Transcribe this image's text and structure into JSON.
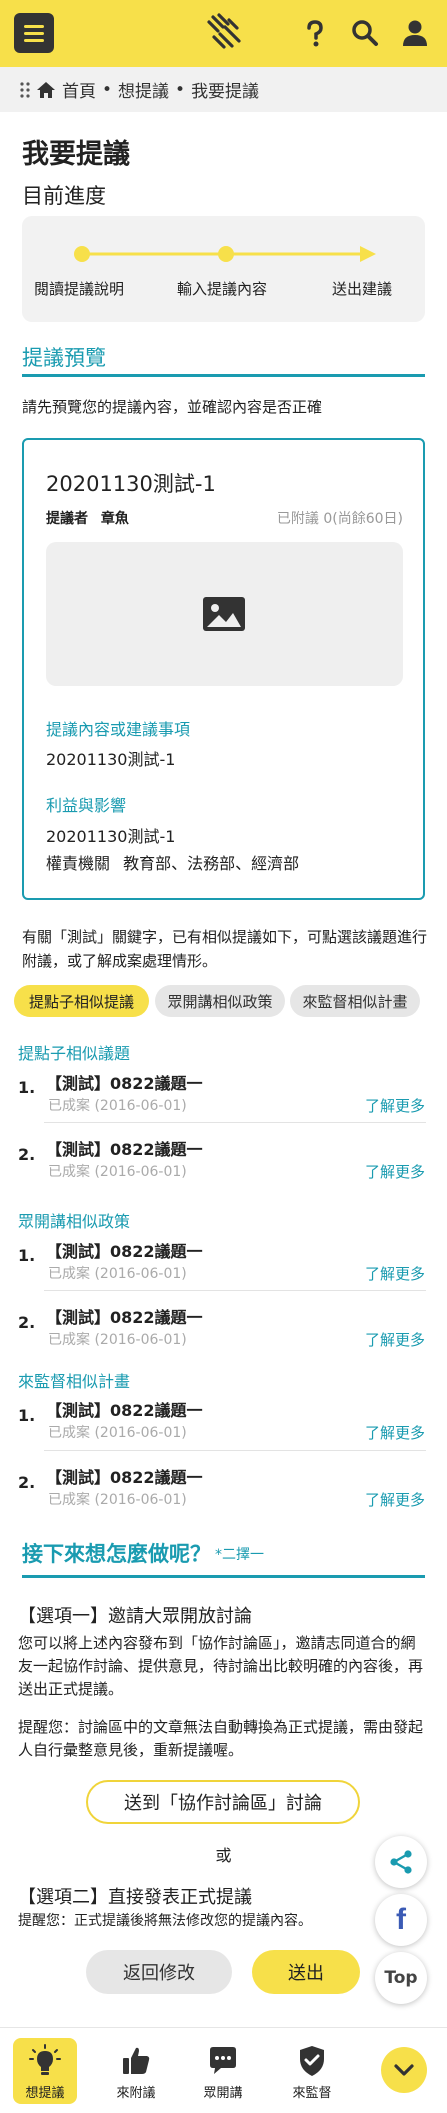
{
  "header": {
    "menu_icon": "hamburger-menu-icon",
    "logo_icon": "hands-logo-icon",
    "help_icon": "question-mark-icon",
    "search_icon": "search-icon",
    "user_icon": "user-icon",
    "accent_color": "#f7e04a"
  },
  "breadcrumb": {
    "home_icon": "home-icon",
    "items": [
      "首頁",
      "想提議",
      "我要提議"
    ],
    "separator": "•"
  },
  "page": {
    "title": "我要提議",
    "progress_label": "目前進度",
    "steps": [
      "閱讀提議說明",
      "輸入提議內容",
      "送出建議"
    ]
  },
  "preview_section": {
    "title": "提議預覽",
    "intro": "請先預覽您的提議內容，並確認內容是否正確",
    "card": {
      "title": "20201130測試-1",
      "proposer_label": "提議者",
      "proposer": "章魚",
      "status": "已附議 0(尚餘60日)",
      "image_icon": "image-placeholder-icon",
      "content_label": "提議內容或建議事項",
      "content_value": "20201130測試-1",
      "impact_label": "利益與影響",
      "impact_value": "20201130測試-1",
      "agency_label": "權責機關",
      "agency_value": "教育部、法務部、經濟部"
    }
  },
  "related": {
    "intro": "有關「測試」關鍵字，已有相似提議如下，可點選該議題進行附議，或了解成案處理情形。",
    "tabs": [
      "提點子相似提議",
      "眾開講相似政策",
      "來監督相似計畫"
    ],
    "groups": [
      {
        "title": "提點子相似議題",
        "items": [
          {
            "num": "1.",
            "title": "【測試】0822議題一",
            "sub": "已成案 (2016-06-01)",
            "more": "了解更多"
          },
          {
            "num": "2.",
            "title": "【測試】0822議題一",
            "sub": "已成案 (2016-06-01)",
            "more": "了解更多"
          }
        ]
      },
      {
        "title": "眾開講相似政策",
        "items": [
          {
            "num": "1.",
            "title": "【測試】0822議題一",
            "sub": "已成案 (2016-06-01)",
            "more": "了解更多"
          },
          {
            "num": "2.",
            "title": "【測試】0822議題一",
            "sub": "已成案 (2016-06-01)",
            "more": "了解更多"
          }
        ]
      },
      {
        "title": "來監督相似計畫",
        "items": [
          {
            "num": "1.",
            "title": "【測試】0822議題一",
            "sub": "已成案 (2016-06-01)",
            "more": "了解更多"
          },
          {
            "num": "2.",
            "title": "【測試】0822議題一",
            "sub": "已成案 (2016-06-01)",
            "more": "了解更多"
          }
        ]
      }
    ]
  },
  "next_steps": {
    "title": "接下來想怎麼做呢？",
    "badge": "*二擇一",
    "option1_title": "【選項一】邀請大眾開放討論",
    "option1_body": "您可以將上述內容發布到「協作討論區」，邀請志同道合的網友一起協作討論、提供意見，待討論出比較明確的內容後，再送出正式提議。",
    "option1_note": "提醒您：討論區中的文章無法自動轉換為正式提議，需由發起人自行彙整意見後，重新提議喔。",
    "discuss_button": "送到「協作討論區」討論",
    "or_text": "或",
    "option2_title": "【選項二】直接發表正式提議",
    "option2_note": "提醒您：正式提議後將無法修改您的提議內容。",
    "back_button": "返回修改",
    "send_button": "送出"
  },
  "floating": {
    "share_icon": "share-icon",
    "facebook_icon": "facebook-icon",
    "facebook_letter": "f",
    "top_label": "Top"
  },
  "bottom_nav": {
    "items": [
      {
        "label": "想提議",
        "icon": "lightbulb-icon"
      },
      {
        "label": "來附議",
        "icon": "thumbs-up-icon"
      },
      {
        "label": "眾開講",
        "icon": "chat-bubble-icon"
      },
      {
        "label": "來監督",
        "icon": "shield-check-icon"
      }
    ],
    "more_icon": "chevron-down-icon"
  }
}
